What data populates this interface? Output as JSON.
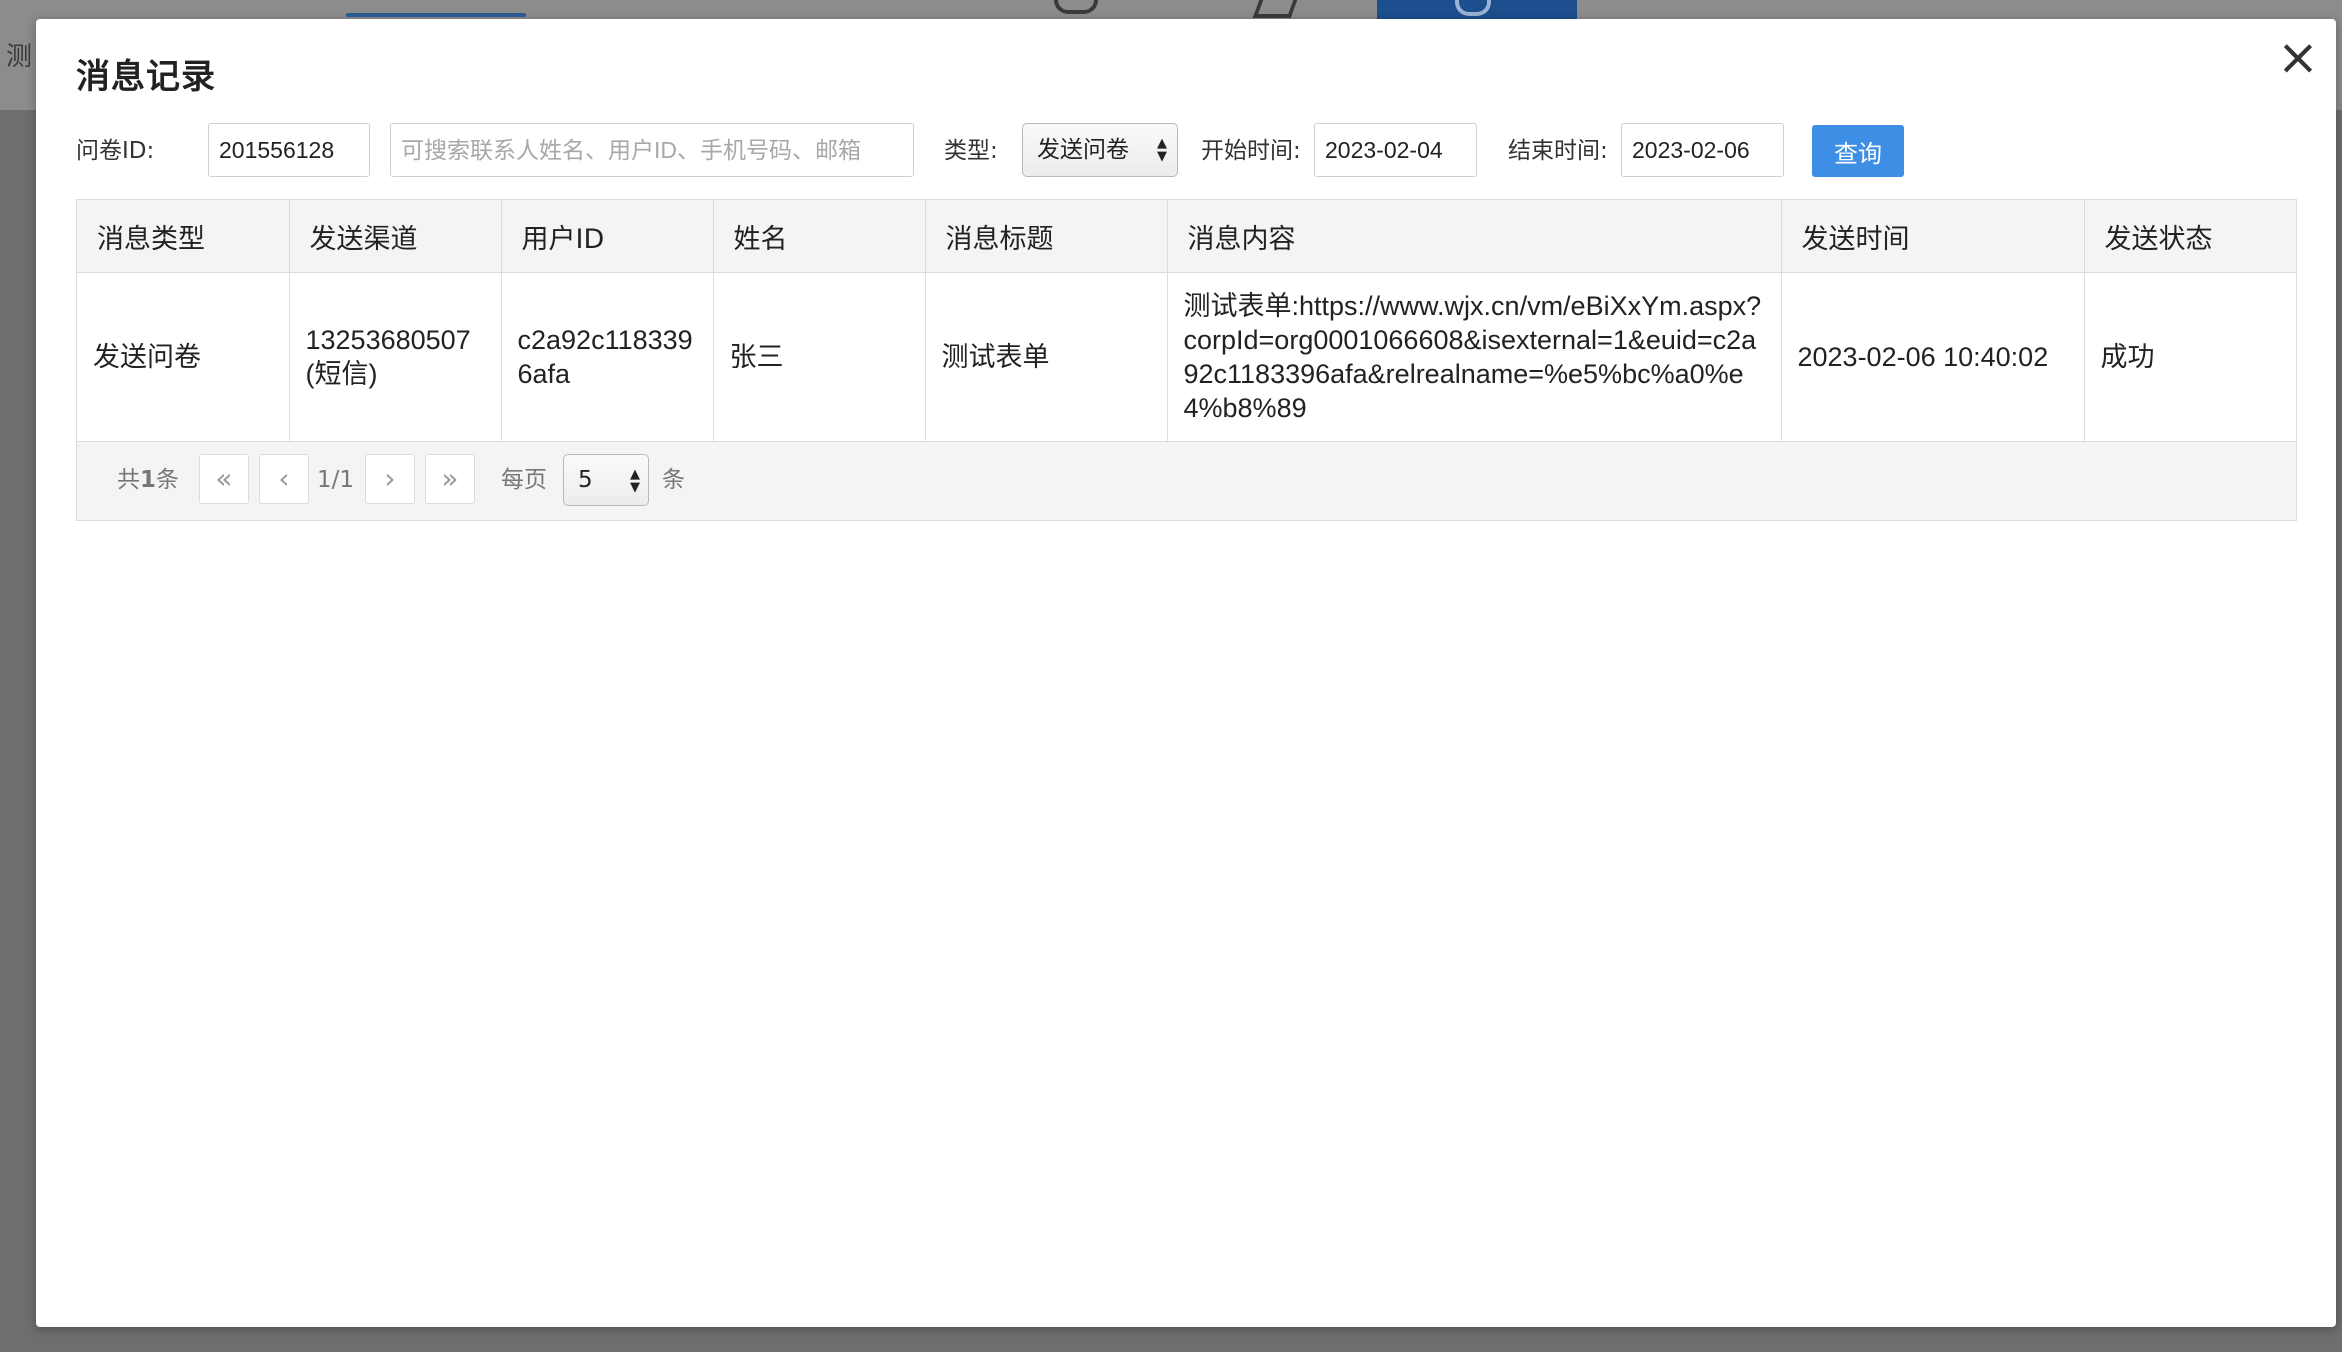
{
  "background": {
    "partial_char": "测"
  },
  "modal": {
    "title": "消息记录",
    "close_icon": "×"
  },
  "filters": {
    "survey_id_label": "问卷ID:",
    "survey_id_value": "201556128",
    "search_placeholder": "可搜索联系人姓名、用户ID、手机号码、邮箱",
    "type_label": "类型:",
    "type_value": "发送问卷",
    "start_label": "开始时间:",
    "start_value": "2023-02-04",
    "end_label": "结束时间:",
    "end_value": "2023-02-06",
    "query_label": "查询"
  },
  "table": {
    "headers": [
      "消息类型",
      "发送渠道",
      "用户ID",
      "姓名",
      "消息标题",
      "消息内容",
      "发送时间",
      "发送状态"
    ],
    "rows": [
      [
        "发送问卷",
        "13253680507(短信)",
        "c2a92c1183396afa",
        "张三",
        "测试表单",
        "测试表单:https://www.wjx.cn/vm/eBiXxYm.aspx?corpId=org0001066608&isexternal=1&euid=c2a92c1183396afa&relrealname=%e5%bc%a0%e4%b8%89",
        "2023-02-06 10:40:02",
        "成功"
      ]
    ]
  },
  "pager": {
    "total_prefix": "共",
    "total_count": "1",
    "total_suffix": "条",
    "first_icon": "«",
    "prev_icon": "‹",
    "page_text": "1/1",
    "next_icon": "›",
    "last_icon": "»",
    "per_page_label": "每页",
    "page_size": "5",
    "per_page_unit": "条"
  },
  "colors": {
    "primary_button": "#3d8fe6",
    "backdrop": "#6e6e6e"
  }
}
